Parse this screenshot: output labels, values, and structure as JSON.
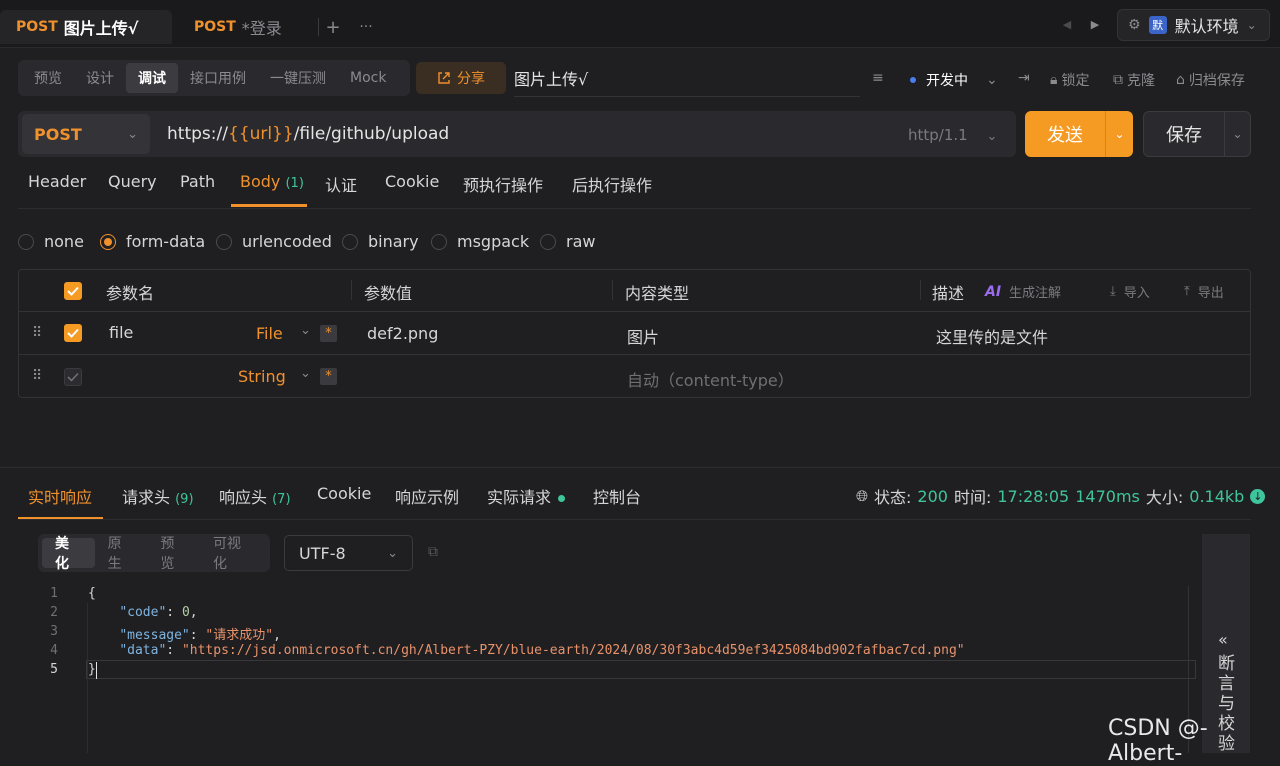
{
  "tabs": [
    {
      "method": "POST",
      "name": "图片上传√",
      "active": true
    },
    {
      "method": "POST",
      "name": "*登录",
      "active": false
    }
  ],
  "env": {
    "icon": "默",
    "label": "默认环境"
  },
  "view_modes": [
    "预览",
    "设计",
    "调试",
    "接口用例",
    "一键压测",
    "Mock"
  ],
  "active_view": "调试",
  "share_label": "分享",
  "request_name": "图片上传√",
  "toolbar": {
    "status_label": "开发中",
    "lock_label": "锁定",
    "clone_label": "克隆",
    "archive_label": "归档保存"
  },
  "url_bar": {
    "method": "POST",
    "prefix": "https://",
    "var": "{{url}}",
    "path": "/file/github/upload",
    "http_version": "http/1.1",
    "send_label": "发送",
    "save_label": "保存"
  },
  "request_tabs": [
    "Header",
    "Query",
    "Path",
    "Body",
    "认证",
    "Cookie",
    "预执行操作",
    "后执行操作"
  ],
  "body_count": "(1)",
  "body_types": [
    "none",
    "form-data",
    "urlencoded",
    "binary",
    "msgpack",
    "raw"
  ],
  "selected_body_type": "form-data",
  "table": {
    "headers": {
      "name": "参数名",
      "value": "参数值",
      "content_type": "内容类型",
      "desc": "描述",
      "ai_label": "生成注解",
      "import_label": "导入",
      "export_label": "导出"
    },
    "rows": [
      {
        "name": "file",
        "type": "File",
        "value": "def2.png",
        "content_type": "图片",
        "desc": "这里传的是文件"
      },
      {
        "name": "",
        "type": "String",
        "value": "",
        "content_type": "自动（content-type）",
        "desc": ""
      }
    ]
  },
  "response_tabs": [
    {
      "label": "实时响应",
      "count": ""
    },
    {
      "label": "请求头",
      "count": "(9)"
    },
    {
      "label": "响应头",
      "count": "(7)"
    },
    {
      "label": "Cookie",
      "count": ""
    },
    {
      "label": "响应示例",
      "count": ""
    },
    {
      "label": "实际请求",
      "count": ""
    },
    {
      "label": "控制台",
      "count": ""
    }
  ],
  "status_bar": {
    "status_label": "状态:",
    "status": "200",
    "time_label": "时间:",
    "time": "17:28:05",
    "duration": "1470ms",
    "size_label": "大小:",
    "size": "0.14kb"
  },
  "format_modes": [
    "美化",
    "原生",
    "预览",
    "可视化"
  ],
  "active_format": "美化",
  "encoding": "UTF-8",
  "code_lines": [
    "1",
    "2",
    "3",
    "4",
    "5"
  ],
  "response_json": {
    "code_key": "\"code\"",
    "code_val": "0",
    "message_key": "\"message\"",
    "message_val": "\"请求成功\"",
    "data_key": "\"data\"",
    "data_val": "\"https://jsd.onmicrosoft.cn/gh/Albert-PZY/blue-earth/2024/08/30f3abc4d59ef3425084bd902fafbac7cd.png\""
  },
  "side_panel_label": "断言与校验",
  "watermark": "CSDN @-Albert-",
  "colors": {
    "accent": "#f0912c",
    "success": "#3fc59b",
    "send_button": "#f59a23"
  }
}
